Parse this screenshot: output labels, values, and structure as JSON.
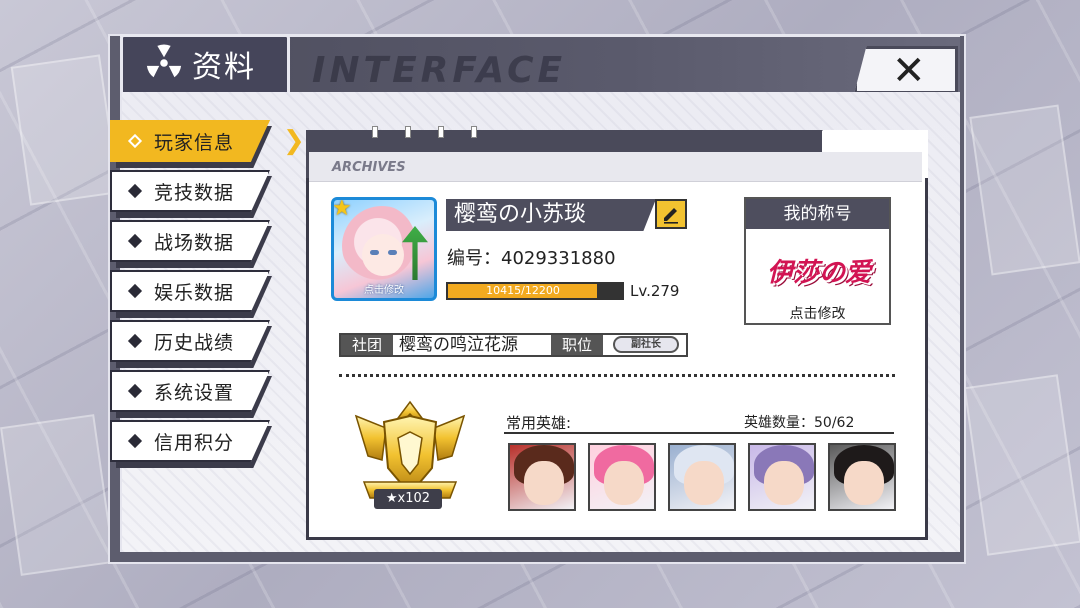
{
  "window": {
    "title": "资料",
    "watermark": "INTERFACE",
    "close_label": "✕"
  },
  "sidebar": {
    "items": [
      {
        "label": "玩家信息",
        "active": true
      },
      {
        "label": "竞技数据",
        "active": false
      },
      {
        "label": "战场数据",
        "active": false
      },
      {
        "label": "娱乐数据",
        "active": false
      },
      {
        "label": "历史战绩",
        "active": false
      },
      {
        "label": "系统设置",
        "active": false
      },
      {
        "label": "信用积分",
        "active": false
      }
    ]
  },
  "panel": {
    "header": "ARCHIVES"
  },
  "profile": {
    "avatar_caption": "点击修改",
    "name": "樱鸾の小苏琰",
    "id_label": "编号：",
    "id_value": "4029331880",
    "exp_text": "10415/12200",
    "exp_fraction": 0.854,
    "level": "Lv.279"
  },
  "club": {
    "club_tag": "社团",
    "club_name": "樱鸾の鸣泣花源",
    "position_tag": "职位",
    "position_badge": "副社长"
  },
  "title_card": {
    "header": "我的称号",
    "title_art": "伊莎の爱",
    "footer": "点击修改"
  },
  "crest": {
    "count": "★x102"
  },
  "heroes": {
    "label": "常用英雄:",
    "count": "英雄数量：50/62",
    "list": [
      {
        "name": "hero-1",
        "hair": "#5a2a1c",
        "accent": "#b8302a"
      },
      {
        "name": "hero-2",
        "hair": "#f06aa0",
        "accent": "#ffd0de"
      },
      {
        "name": "hero-3",
        "hair": "#dfe6f2",
        "accent": "#9ab0d0"
      },
      {
        "name": "hero-4",
        "hair": "#8a78b8",
        "accent": "#c8b8e8"
      },
      {
        "name": "hero-5",
        "hair": "#1e1a1a",
        "accent": "#5a5a5a"
      }
    ]
  },
  "colors": {
    "accent": "#f2b820",
    "dark": "#4a4a5a",
    "exp_fill": "#f2aa20"
  }
}
